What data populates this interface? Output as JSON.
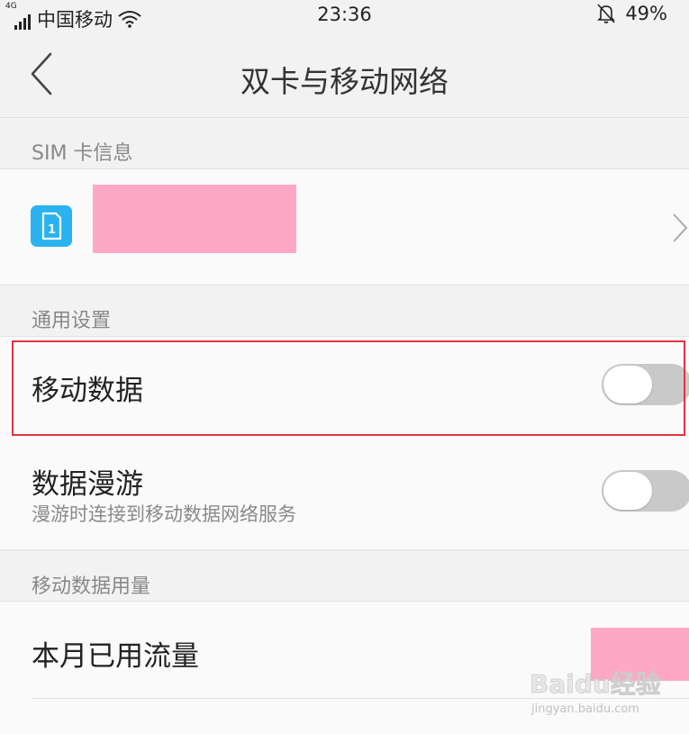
{
  "status_bar": {
    "network_type": "4G",
    "carrier": "中国移动",
    "time": "23:36",
    "battery": "49%"
  },
  "header": {
    "title": "双卡与移动网络"
  },
  "sim_section": {
    "label": "SIM 卡信息",
    "sim_slot": "1"
  },
  "general_section": {
    "label": "通用设置",
    "mobile_data": {
      "title": "移动数据",
      "enabled": false
    },
    "data_roaming": {
      "title": "数据漫游",
      "subtitle": "漫游时连接到移动数据网络服务",
      "enabled": false
    }
  },
  "usage_section": {
    "label": "移动数据用量",
    "monthly_usage": {
      "title": "本月已用流量"
    }
  },
  "watermark": {
    "logo": "Baidu经验",
    "url": "jingyan.baidu.com"
  },
  "colors": {
    "accent_highlight": "#e0363d",
    "sim_icon": "#2ab3f0",
    "redaction": "#ffa8c6",
    "toggle_off": "#c9c9c9"
  }
}
